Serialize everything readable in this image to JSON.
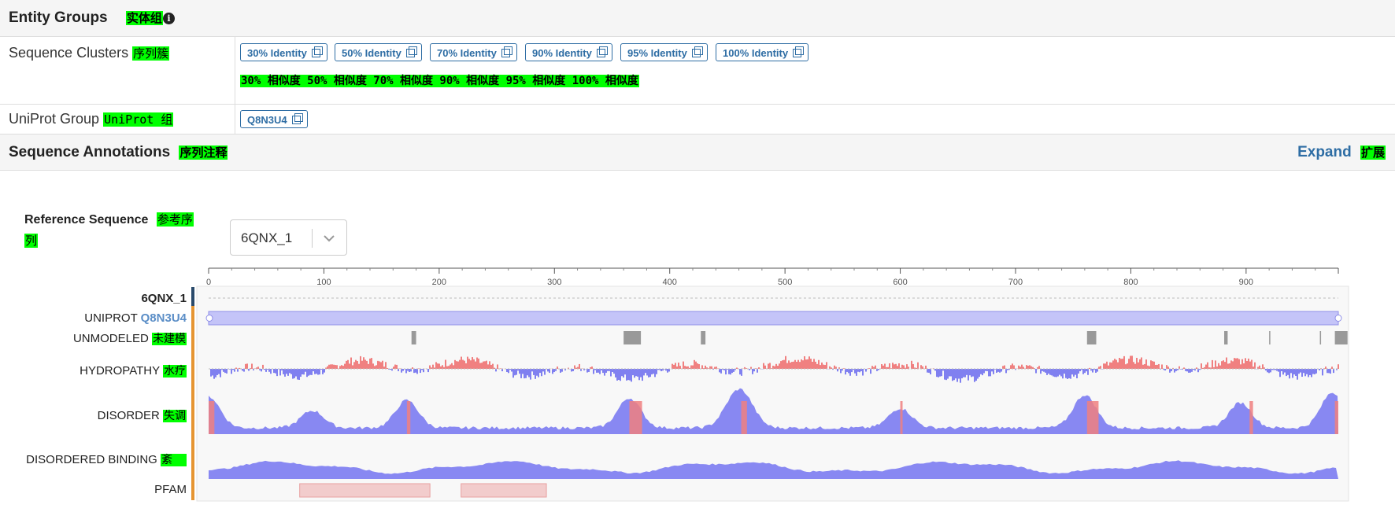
{
  "entity_groups": {
    "title": "Entity Groups",
    "title_zh": "实体组",
    "info_icon": "info-icon"
  },
  "sequence_clusters": {
    "label": "Sequence Clusters",
    "label_zh": "序列簇",
    "chips": [
      "30% Identity",
      "50% Identity",
      "70% Identity",
      "90% Identity",
      "95% Identity",
      "100% Identity"
    ],
    "zh_line": "30% 相似度 50% 相似度 70% 相似度 90% 相似度 95% 相似度 100% 相似度"
  },
  "uniprot_group": {
    "label": "UniProt Group",
    "label_zh": "UniProt 组",
    "chip": "Q8N3U4"
  },
  "sequence_annotations": {
    "title": "Sequence Annotations",
    "title_zh": "序列注释",
    "expand": "Expand",
    "expand_zh": "扩展"
  },
  "reference": {
    "label": "Reference Sequence",
    "label_zh_1": "参考序",
    "label_zh_2": "列",
    "selected": "6QNX_1"
  },
  "axis": {
    "ticks": [
      "0",
      "100",
      "200",
      "300",
      "400",
      "500",
      "600",
      "700",
      "800",
      "900"
    ],
    "max": 980
  },
  "tracks": {
    "seq": "6QNX_1",
    "uniprot_prefix": "UNIPROT",
    "uniprot_id": "Q8N3U4",
    "unmodeled": "UNMODELED",
    "unmodeled_zh": "未建模",
    "hydropathy": "HYDROPATHY",
    "hydropathy_zh": "水疗",
    "disorder": "DISORDER",
    "disorder_zh": "失调",
    "disordered_binding": "DISORDERED BINDING",
    "disordered_binding_zh": "紊",
    "pfam": "PFAM"
  },
  "unmodeled_regions": [
    [
      176,
      180
    ],
    [
      360,
      375
    ],
    [
      427,
      431
    ],
    [
      762,
      770
    ],
    [
      881,
      884
    ],
    [
      920,
      921
    ],
    [
      964,
      965
    ],
    [
      977,
      988
    ]
  ],
  "pfam_regions": [
    [
      79,
      192
    ],
    [
      219,
      293
    ]
  ],
  "colors": {
    "accent": "#2e6da4",
    "highlight": "#00ff00",
    "positive": "#f08080",
    "negative": "#8080f0",
    "uniprot_bar": "#c4c4f8",
    "pfam": "#f2cccc",
    "track_bg": "#f8f8f8"
  }
}
